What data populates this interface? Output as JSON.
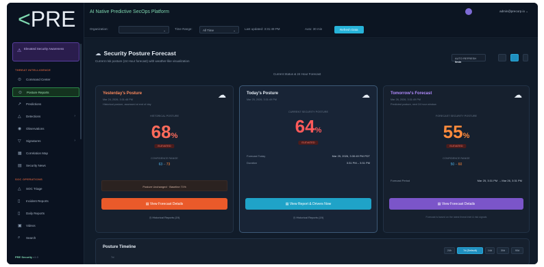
{
  "sidebar": {
    "logo_bracket": "<",
    "logo_text": "PRE",
    "alert": "Elevated Security Awareness",
    "section1": "THREAT INTELLIGENCE",
    "items1": [
      {
        "label": "Command Center",
        "icon": "home-icon"
      },
      {
        "label": "Posture Reports",
        "icon": "shield-icon"
      },
      {
        "label": "Predictions",
        "icon": "chart-icon"
      },
      {
        "label": "Detections",
        "icon": "warning-icon"
      },
      {
        "label": "Observations",
        "icon": "eye-icon"
      },
      {
        "label": "Signatures",
        "icon": "filter-icon"
      },
      {
        "label": "Correlation Map",
        "icon": "map-icon"
      },
      {
        "label": "Security News",
        "icon": "news-icon"
      }
    ],
    "section2": "SOC OPERATIONS",
    "items2": [
      {
        "label": "SOC Triage",
        "icon": "triage-icon"
      },
      {
        "label": "Incident Reports",
        "icon": "doc-icon"
      },
      {
        "label": "Daily Reports",
        "icon": "doc-icon"
      },
      {
        "label": "Videos",
        "icon": "video-icon"
      },
      {
        "label": "Search",
        "icon": "search-icon"
      }
    ],
    "footer_name": "PRE Security",
    "footer_version": "v1.0"
  },
  "header": {
    "platform_title": "AI Native Predictive SecOps Platform",
    "user": "admin@precorp.io",
    "filter_org_label": "Organization:",
    "filter_org_value": "",
    "filter_range_label": "Time Range:",
    "filter_range_value": "All Time",
    "filter_updated": "Last updated: 3:31:49 PM",
    "filter_auto": "Auto: 30 min",
    "apply_label": "Refresh Data"
  },
  "main": {
    "title": "Security Posture Forecast",
    "subtitle": "Current risk posture (24 Hour forecast) with weather-like visualization",
    "current_status": "Current Status & 24 Hour Forecast",
    "autorefresh_label": "AUTO REFRESH",
    "autorefresh_value": "5min"
  },
  "cards": [
    {
      "title": "Yesterday's Posture",
      "title_color": "#ff8a5c",
      "date": "Mar 24, 2026, 3:31:48 PM",
      "sub": "Historical posture, assessed at end of day",
      "score_label": "HISTORICAL POSTURE",
      "score": "68",
      "pct": "%",
      "score_color": "#ff6b5b",
      "badge": "ELEVATED",
      "range_label": "CONFIDENCE RANGE",
      "range_low": "63",
      "range_high": "73",
      "banner": "Posture Unchanged · Baseline 71%",
      "cta": "View Forecast Details",
      "hist": "Historical Reports (19)"
    },
    {
      "title": "Today's Posture",
      "title_color": "#e6edf5",
      "date": "Mar 25, 2026, 3:31:49 PM",
      "sub": "",
      "score_label": "CURRENT SECURITY POSTURE",
      "score": "64",
      "pct": "%",
      "score_color": "#ff5a5a",
      "badge": "ELEVATED",
      "kv1_label": "Forecast Today",
      "kv1_value": "Mar 25, 2026, 3:30:49 PM PDT",
      "kv2_label": "Duration",
      "kv2_value": "3:31 PM – 3:31 PM",
      "cta": "View Report & Drivers Now",
      "hist": "Historical Reports (19)"
    },
    {
      "title": "Tomorrow's Forecast",
      "title_color": "#b38cff",
      "date": "Mar 26, 2026, 3:31:49 PM",
      "sub": "Predicted posture, next 24 hour window",
      "score_label": "FORECAST SECURITY POSTURE",
      "score": "55",
      "pct": "%",
      "score_color": "#ff8a3c",
      "badge": "ELEVATED",
      "range_label": "CONFIDENCE RANGE",
      "range_low": "50",
      "range_high": "60",
      "kv1_label": "Forecast Period",
      "kv1_value": "Mar 25, 3:31 PM → Mar 26, 3:31 PM",
      "cta": "View Forecast Details",
      "note": "Forecast is based on the latest threat intel & risk signals"
    }
  ],
  "timeline": {
    "title": "Posture Timeline",
    "sub": "7d",
    "pills": [
      "24h",
      "7d (Default)",
      "14d",
      "30d",
      "90d"
    ]
  }
}
